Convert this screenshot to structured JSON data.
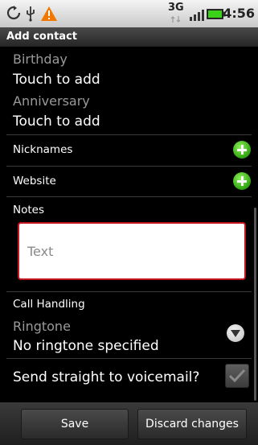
{
  "status_bar": {
    "network_label": "3G",
    "time": "4:56",
    "icons": [
      "sync-icon",
      "usb-icon",
      "warning-icon",
      "signal-icon",
      "battery-icon"
    ]
  },
  "title": "Add contact",
  "birthday": {
    "label": "Birthday",
    "value": "Touch to add"
  },
  "anniversary": {
    "label": "Anniversary",
    "value": "Touch to add"
  },
  "nicknames": {
    "label": "Nicknames"
  },
  "website": {
    "label": "Website"
  },
  "notes": {
    "label": "Notes",
    "placeholder": "Text"
  },
  "call_handling": {
    "label": "Call Handling",
    "ringtone_label": "Ringtone",
    "ringtone_value": "No ringtone specified",
    "voicemail_label": "Send straight to voicemail?"
  },
  "buttons": {
    "save": "Save",
    "discard": "Discard changes"
  },
  "colors": {
    "add_green": "#2fa410",
    "focus_red": "#c4141e",
    "background": "#000000"
  }
}
